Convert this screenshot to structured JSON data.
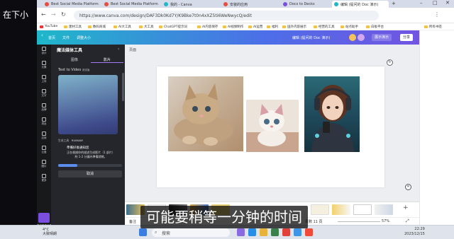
{
  "overlay_text": "在下小",
  "browser": {
    "tabs": [
      {
        "label": "Best Social Media Platform",
        "color": "#e94e3c"
      },
      {
        "label": "Best Social Media Platform",
        "color": "#e94e3c"
      },
      {
        "label": "我的 - Canva",
        "color": "#1fb7c9"
      },
      {
        "label": "安装的应用",
        "color": "#e94e3c"
      },
      {
        "label": "Docs to Decks",
        "color": "#7a4fe0"
      },
      {
        "label": "编辑 (提问的 Doc 演示)",
        "color": "#1fb7c9"
      }
    ],
    "url": "https://www.canva.com/design/DAF3Dk0Kd7Y/K9Bke7t0n4xXZ5ti6WeNwycQ/edit",
    "bookmarks": [
      "YouTube",
      "建材工具",
      "数码商城",
      "AI大工具",
      "大工具",
      "ChatGPT提示词",
      "AI内容保存",
      "AI视频制作",
      "AI运营",
      "福利",
      "国外内容展示",
      "经营的工具",
      "站点助手",
      "白板平台",
      "所有书签"
    ]
  },
  "canva_header": {
    "home": "首页",
    "file": "文件",
    "resize": "调整大小",
    "title": "编辑 (提问的 Doc 演示)",
    "present": "展示演示",
    "share": "分享"
  },
  "rail": [
    "设计",
    "元素",
    "上传",
    "文字",
    "品牌",
    "项目",
    "应用",
    "云盘",
    "图片",
    "更多"
  ],
  "rail_bottom": "魔法媒体工具",
  "panel": {
    "title": "魔法媒体工具",
    "tab_image": "图像",
    "tab_video": "影片",
    "section": "Text to Video",
    "beta": "测试版",
    "generated_by": "生成工具",
    "provider": "RUNWAY",
    "status_title": "準備好後通知您",
    "status_line1": "正在根據你的描述生成影片（1 部片）",
    "status_line2": "約 1-2 分鐘內準備就緒。",
    "progress": 0.3,
    "cancel": "取消"
  },
  "main": {
    "page_label": "頁面"
  },
  "status": {
    "notes": "备注",
    "page_indicator": "頁數 11 頁",
    "zoom": "57%"
  },
  "subtitle": "可能要稍等一分钟的时间",
  "taskbar": {
    "weather_temp": "4°C",
    "weather_desc": "大致晴朗",
    "search_placeholder": "搜索",
    "time": "22:29",
    "date": "2023/12/15"
  }
}
